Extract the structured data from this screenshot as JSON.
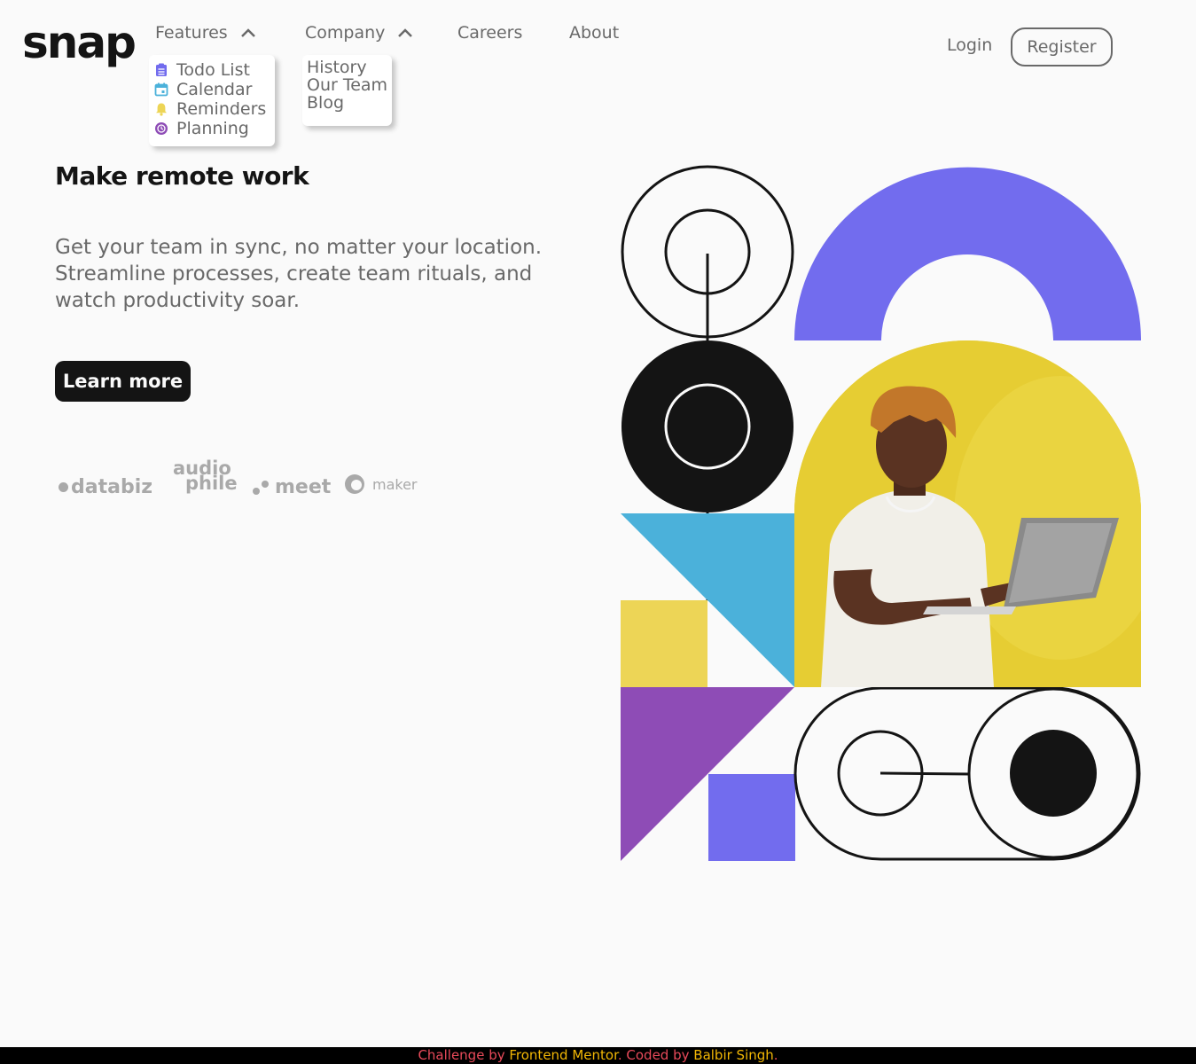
{
  "brand": {
    "logo": "snap"
  },
  "nav": {
    "features": {
      "label": "Features",
      "items": [
        {
          "label": "Todo List",
          "icon": "todo-icon",
          "color": "#726CEE"
        },
        {
          "label": "Calendar",
          "icon": "calendar-icon",
          "color": "#4BB1DA"
        },
        {
          "label": "Reminders",
          "icon": "bell-icon",
          "color": "#EDD556"
        },
        {
          "label": "Planning",
          "icon": "planning-icon",
          "color": "#8E4CB6"
        }
      ]
    },
    "company": {
      "label": "Company",
      "items": [
        {
          "label": "History"
        },
        {
          "label": "Our Team"
        },
        {
          "label": "Blog"
        }
      ]
    },
    "careers": "Careers",
    "about": "About",
    "login": "Login",
    "register": "Register"
  },
  "hero": {
    "title": "Make remote work",
    "text": "Get your team in sync, no matter your location. Streamline processes, create team rituals, and watch productivity soar.",
    "cta": "Learn more"
  },
  "clients": {
    "databiz": "databiz",
    "audiophile_top": "audio",
    "audiophile_bottom": "phile",
    "meet": "meet",
    "maker": "maker"
  },
  "footer": {
    "challenge_by": "Challenge by ",
    "frontend_mentor": "Frontend Mentor",
    "coded_by": ". Coded by ",
    "author": "Balbir Singh",
    "end": "."
  },
  "colors": {
    "background": "#FAFAFA",
    "text_dark": "#141414",
    "text_gray": "#696969",
    "purple": "#726CEE",
    "blue": "#4BB1DA",
    "yellow": "#EDD556",
    "violet": "#8E4CB6"
  }
}
